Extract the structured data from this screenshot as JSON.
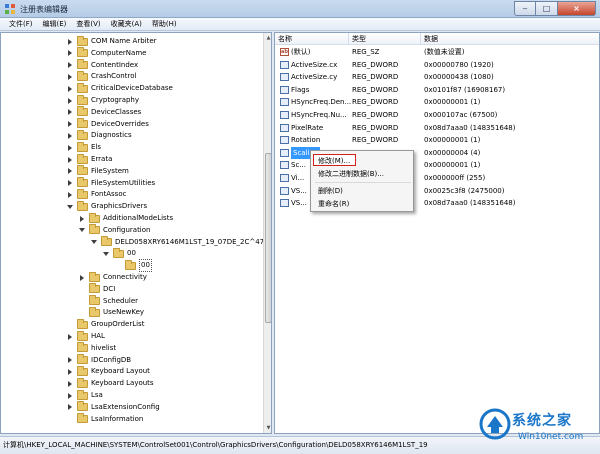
{
  "window": {
    "title": "注册表编辑器",
    "min_glyph": "‒",
    "max_glyph": "□",
    "close_glyph": "×"
  },
  "menu": [
    "文件(F)",
    "编辑(E)",
    "查看(V)",
    "收藏夹(A)",
    "帮助(H)"
  ],
  "tree": [
    {
      "label": "COM Name Arbiter",
      "expander": "collapsed",
      "level": 0
    },
    {
      "label": "ComputerName",
      "expander": "collapsed",
      "level": 0
    },
    {
      "label": "ContentIndex",
      "expander": "collapsed",
      "level": 0
    },
    {
      "label": "CrashControl",
      "expander": "collapsed",
      "level": 0
    },
    {
      "label": "CriticalDeviceDatabase",
      "expander": "collapsed",
      "level": 0
    },
    {
      "label": "Cryptography",
      "expander": "collapsed",
      "level": 0
    },
    {
      "label": "DeviceClasses",
      "expander": "collapsed",
      "level": 0
    },
    {
      "label": "DeviceOverrides",
      "expander": "collapsed",
      "level": 0
    },
    {
      "label": "Diagnostics",
      "expander": "collapsed",
      "level": 0
    },
    {
      "label": "Els",
      "expander": "collapsed",
      "level": 0
    },
    {
      "label": "Errata",
      "expander": "collapsed",
      "level": 0
    },
    {
      "label": "FileSystem",
      "expander": "collapsed",
      "level": 0
    },
    {
      "label": "FileSystemUtilities",
      "expander": "collapsed",
      "level": 0
    },
    {
      "label": "FontAssoc",
      "expander": "collapsed",
      "level": 0
    },
    {
      "label": "GraphicsDrivers",
      "expander": "expanded",
      "level": 0
    },
    {
      "label": "AdditionalModeLists",
      "expander": "collapsed",
      "level": 1
    },
    {
      "label": "Configuration",
      "expander": "expanded",
      "level": 1
    },
    {
      "label": "DELD058XRY6146M1LST_19_07DE_2C^47BC",
      "expander": "expanded",
      "level": 2
    },
    {
      "label": "00",
      "expander": "expanded",
      "level": 3
    },
    {
      "label": "00",
      "expander": "none",
      "level": 4,
      "selected": true
    },
    {
      "label": "Connectivity",
      "expander": "collapsed",
      "level": 1
    },
    {
      "label": "DCI",
      "expander": "none",
      "level": 1
    },
    {
      "label": "Scheduler",
      "expander": "none",
      "level": 1
    },
    {
      "label": "UseNewKey",
      "expander": "none",
      "level": 1
    },
    {
      "label": "GroupOrderList",
      "expander": "none",
      "level": 0
    },
    {
      "label": "HAL",
      "expander": "collapsed",
      "level": 0
    },
    {
      "label": "hivelist",
      "expander": "none",
      "level": 0
    },
    {
      "label": "IDConfigDB",
      "expander": "collapsed",
      "level": 0
    },
    {
      "label": "Keyboard Layout",
      "expander": "collapsed",
      "level": 0
    },
    {
      "label": "Keyboard Layouts",
      "expander": "collapsed",
      "level": 0
    },
    {
      "label": "Lsa",
      "expander": "collapsed",
      "level": 0
    },
    {
      "label": "LsaExtensionConfig",
      "expander": "collapsed",
      "level": 0
    },
    {
      "label": "LsaInformation",
      "expander": "none",
      "level": 0
    }
  ],
  "columns": {
    "name": "名称",
    "type": "类型",
    "data": "数据"
  },
  "values": [
    {
      "name": "(默认)",
      "type": "REG_SZ",
      "data": "(数值未设置)",
      "icon": "string"
    },
    {
      "name": "ActiveSize.cx",
      "type": "REG_DWORD",
      "data": "0x00000780 (1920)",
      "icon": "binary"
    },
    {
      "name": "ActiveSize.cy",
      "type": "REG_DWORD",
      "data": "0x00000438 (1080)",
      "icon": "binary"
    },
    {
      "name": "Flags",
      "type": "REG_DWORD",
      "data": "0x0101f87 (16908167)",
      "icon": "binary"
    },
    {
      "name": "HSyncFreq.Den...",
      "type": "REG_DWORD",
      "data": "0x00000001 (1)",
      "icon": "binary"
    },
    {
      "name": "HSyncFreq.Nu...",
      "type": "REG_DWORD",
      "data": "0x000107ac (67500)",
      "icon": "binary"
    },
    {
      "name": "PixelRate",
      "type": "REG_DWORD",
      "data": "0x08d7aaa0 (148351648)",
      "icon": "binary"
    },
    {
      "name": "Rotation",
      "type": "REG_DWORD",
      "data": "0x00000001 (1)",
      "icon": "binary"
    },
    {
      "name": "Scaling",
      "type": "REG_DWORD",
      "data": "0x00000004 (4)",
      "icon": "binary",
      "selected": true
    },
    {
      "name": "Sc...",
      "type": "",
      "data": "0x00000001 (1)",
      "icon": "binary"
    },
    {
      "name": "Vi...",
      "type": "",
      "data": "0x000000ff (255)",
      "icon": "binary"
    },
    {
      "name": "VS...",
      "type": "",
      "data": "0x0025c3f8 (2475000)",
      "icon": "binary"
    },
    {
      "name": "VS...",
      "type": "",
      "data": "0x08d7aaa0 (148351648)",
      "icon": "binary"
    }
  ],
  "context_menu": {
    "modify": "修改(M)...",
    "modify_binary": "修改二进制数据(B)...",
    "delete": "删除(D)",
    "rename": "重命名(R)"
  },
  "status": "计算机\\HKEY_LOCAL_MACHINE\\SYSTEM\\ControlSet001\\Control\\GraphicsDrivers\\Configuration\\DELD058XRY6146M1LST_19",
  "watermark": {
    "title": "系统之家",
    "subtitle": "Win10net.com"
  },
  "colors": {
    "selection": "#3399ff",
    "highlight_border": "#d0201f",
    "watermark": "#1a76c9"
  }
}
